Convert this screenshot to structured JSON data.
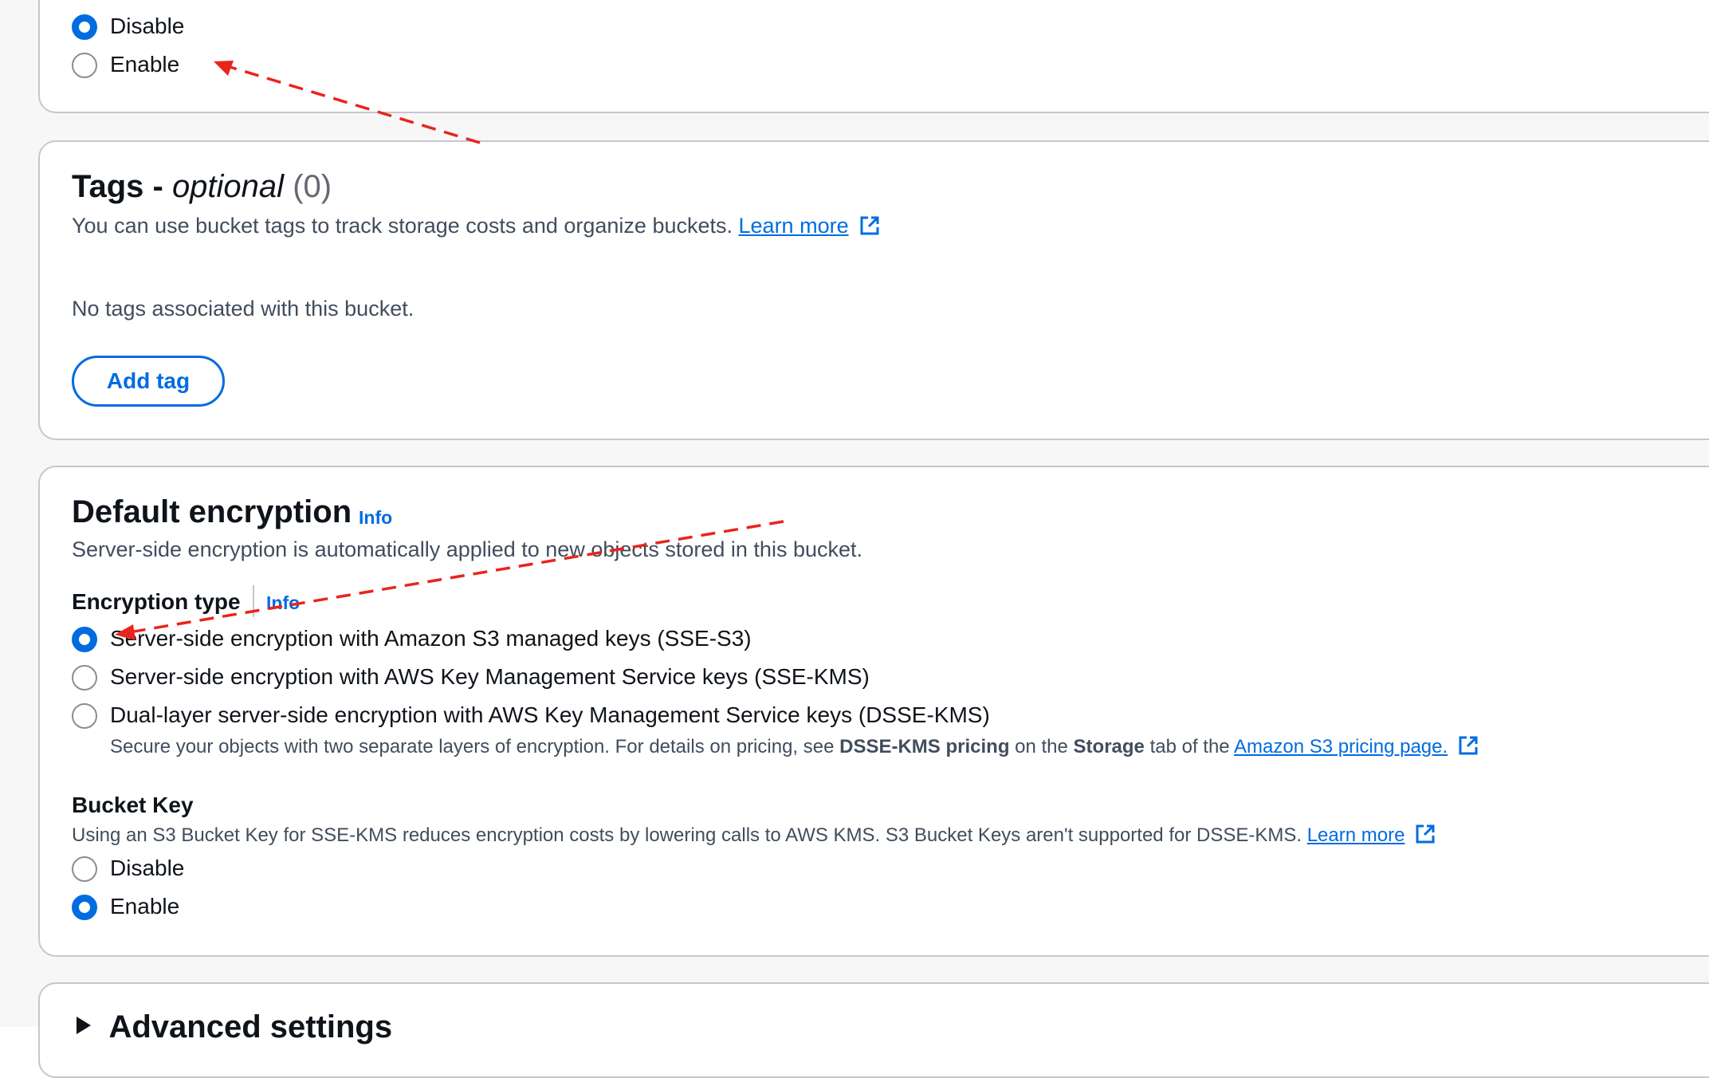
{
  "top_section": {
    "options": [
      {
        "label": "Disable",
        "checked": true
      },
      {
        "label": "Enable",
        "checked": false
      }
    ]
  },
  "tags": {
    "title": "Tags - ",
    "title_italic": "optional",
    "count": "(0)",
    "description": "You can use bucket tags to track storage costs and organize buckets.",
    "learn_more": "Learn more",
    "empty_text": "No tags associated with this bucket.",
    "add_tag_label": "Add tag"
  },
  "default_encryption": {
    "title": "Default encryption",
    "info": "Info",
    "description": "Server-side encryption is automatically applied to new objects stored in this bucket.",
    "encryption_type": {
      "label": "Encryption type",
      "info": "Info",
      "options": [
        {
          "label": "Server-side encryption with Amazon S3 managed keys (SSE-S3)",
          "checked": true
        },
        {
          "label": "Server-side encryption with AWS Key Management Service keys (SSE-KMS)",
          "checked": false
        },
        {
          "label": "Dual-layer server-side encryption with AWS Key Management Service keys (DSSE-KMS)",
          "checked": false
        }
      ],
      "dsse_note": {
        "part1": "Secure your objects with two separate layers of encryption. For details on pricing, see ",
        "bold1": "DSSE-KMS pricing",
        "part2": " on the ",
        "bold2": "Storage",
        "part3": " tab of the ",
        "link": "Amazon S3 pricing page."
      }
    },
    "bucket_key": {
      "label": "Bucket Key",
      "description": "Using an S3 Bucket Key for SSE-KMS reduces encryption costs by lowering calls to AWS KMS. S3 Bucket Keys aren't supported for DSSE-KMS.",
      "learn_more": "Learn more",
      "options": [
        {
          "label": "Disable",
          "checked": false
        },
        {
          "label": "Enable",
          "checked": true
        }
      ]
    }
  },
  "advanced": {
    "label": "Advanced settings"
  },
  "colors": {
    "accent": "#006ce0",
    "annotation_arrow": "#e8251c",
    "border": "#c6c6cd"
  }
}
